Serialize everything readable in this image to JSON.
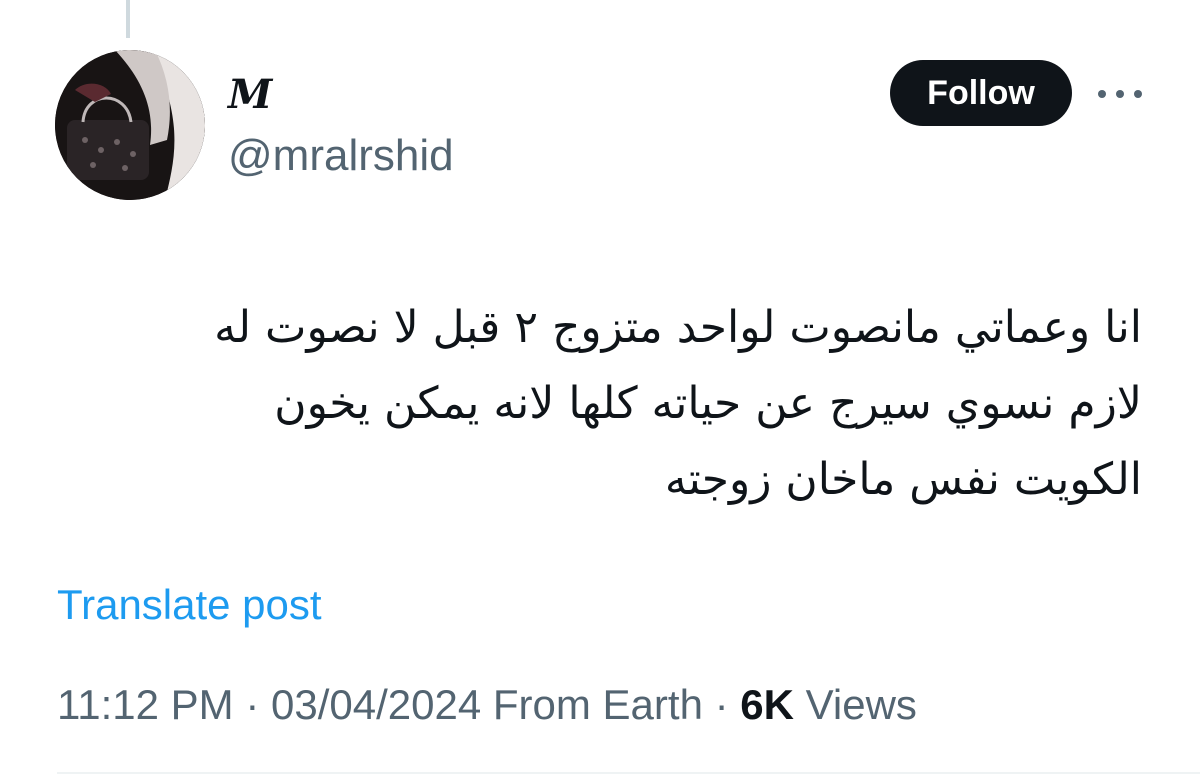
{
  "author": {
    "display_name": "M",
    "handle": "@mralrshid",
    "avatar_icon": "avatar-photo-icon"
  },
  "actions": {
    "follow_label": "Follow",
    "more_icon": "more-horizontal-icon"
  },
  "tweet": {
    "lines": [
      "انا وعماتي مانصوت لواحد متزوج ٢ قبل لا نصوت له",
      "لازم نسوي سيرج عن حياته كلها لانه يمكن يخون",
      "الكويت نفس ماخان زوجته"
    ],
    "translate_label": "Translate post"
  },
  "meta": {
    "time": "11:12 PM",
    "separator": "·",
    "date": "03/04/2024",
    "source": "From Earth",
    "views_count": "6K",
    "views_label": "Views"
  },
  "colors": {
    "text_primary": "#0f1419",
    "text_secondary": "#536471",
    "link": "#1d9bf0",
    "button_bg": "#0f1419",
    "button_text": "#ffffff"
  }
}
